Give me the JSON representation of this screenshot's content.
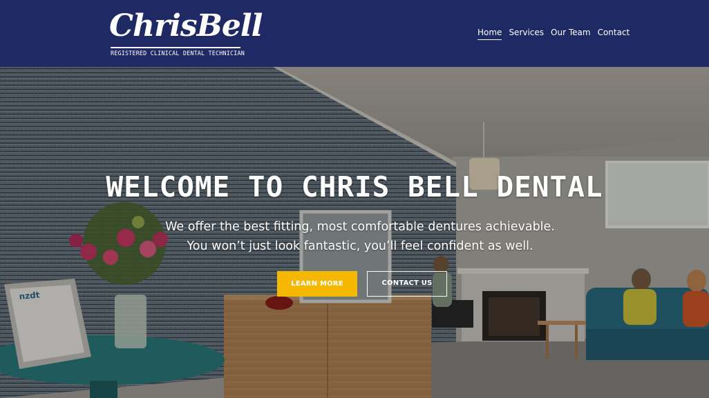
{
  "header": {
    "logo_text": "ChrisBell",
    "logo_tagline": "REGISTERED CLINICAL DENTAL TECHNICIAN",
    "nav": [
      {
        "label": "Home",
        "active": true
      },
      {
        "label": "Services"
      },
      {
        "label": "Our Team"
      },
      {
        "label": "Contact"
      }
    ]
  },
  "hero": {
    "title": "WELCOME TO CHRIS BELL DENTAL",
    "subtitle_line1": "We offer the best fitting, most comfortable dentures achievable.",
    "subtitle_line2": "You won’t just look fantastic, you’ll feel confident as well.",
    "buttons": {
      "learn_more": "LEARN MORE",
      "contact_us": "CONTACT US"
    },
    "certificate_text": "nzdt"
  },
  "colors": {
    "header_bg": "#1f2a64",
    "primary_button": "#f5b800",
    "text": "#ffffff"
  }
}
